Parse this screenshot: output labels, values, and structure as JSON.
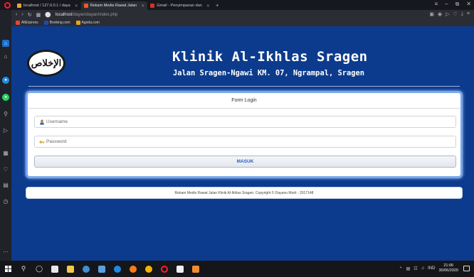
{
  "browser": {
    "tabs": [
      {
        "label": "localhost / 127.0.0.1 / daya",
        "color": "#e8a33a",
        "active": false
      },
      {
        "label": "Rekam Medis Rawat Jalan",
        "color": "#e95b2e",
        "active": true
      },
      {
        "label": "Gmail - Penyimpanan dan",
        "color": "#d93025",
        "active": false
      }
    ],
    "new_tab": "+",
    "window_controls": [
      "≡",
      "–",
      "⧉",
      "✕"
    ],
    "url_host": "localhost",
    "url_path": "/dayan/dayan/index.php",
    "bookmarks": [
      {
        "label": "AliExpress",
        "color": "#e6482b"
      },
      {
        "label": "Booking.com",
        "color": "#1f4aa8"
      },
      {
        "label": "Agoda.com",
        "color": "#e8a21c"
      }
    ]
  },
  "site": {
    "logo_text": "الإخلاص",
    "title": "Klinik Al-Ikhlas Sragen",
    "subtitle": "Jalan Sragen-Ngawi KM. 07, Ngrampal, Sragen"
  },
  "login": {
    "heading": "Form Login",
    "username_placeholder": "Username",
    "password_placeholder": "Password",
    "submit_label": "MASUK"
  },
  "footer": {
    "text": "Rekam Medis Rawat Jalan Klinik Al-Ikhlas Sragen. Copyright © Dayanu Murti - 2017148"
  },
  "taskbar": {
    "tray_lang": "IND",
    "time": "21:06",
    "date": "30/06/2020"
  }
}
